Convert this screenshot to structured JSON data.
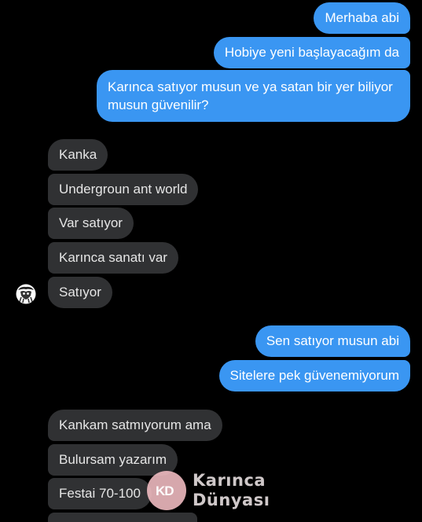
{
  "messages": [
    {
      "text": "Merhaba abi",
      "sender": "me"
    },
    {
      "text": "Hobiye yeni başlayacağım da",
      "sender": "me"
    },
    {
      "text": "Karınca satıyor musun ve ya satan bir yer biliyor musun güvenilir?",
      "sender": "me"
    },
    {
      "text": "Kanka",
      "sender": "other"
    },
    {
      "text": "Undergroun ant world",
      "sender": "other"
    },
    {
      "text": "Var satıyor",
      "sender": "other"
    },
    {
      "text": "Karınca sanatı var",
      "sender": "other"
    },
    {
      "text": "Satıyor",
      "sender": "other"
    },
    {
      "text": "Sen satıyor musun abi",
      "sender": "me"
    },
    {
      "text": "Sitelere pek güvenemiyorum",
      "sender": "me"
    },
    {
      "text": "Kankam satmıyorum ama",
      "sender": "other"
    },
    {
      "text": "Bulursam yazarım",
      "sender": "other"
    },
    {
      "text": "Festai 70-100",
      "sender": "other"
    }
  ],
  "avatar": {
    "icon": "bird-avatar-icon"
  },
  "watermark": {
    "icon": "karinca-dunyasi-logo-icon",
    "mark": "KD",
    "line1": "Karınca",
    "line2": "Dünyası",
    "circle_color": "#f4bec4"
  },
  "colors": {
    "background": "#000000",
    "outgoing_bubble": "#3a96f2",
    "incoming_bubble": "#303133",
    "incoming_text": "#e6e6e6"
  }
}
